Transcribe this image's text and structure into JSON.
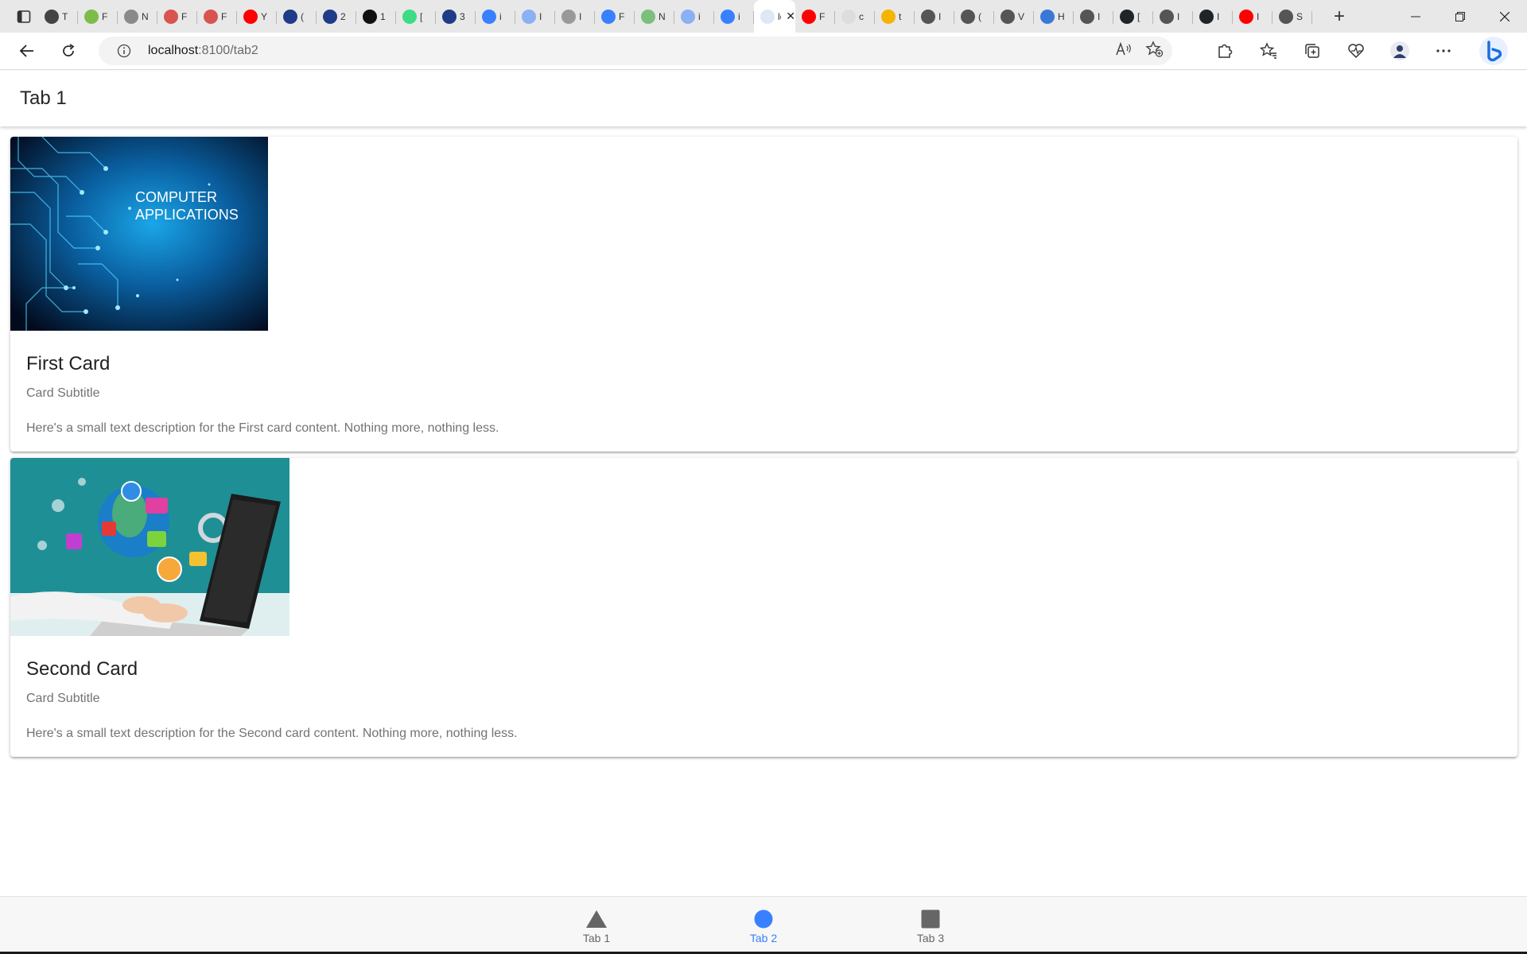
{
  "browser": {
    "tabs": [
      {
        "icon": "copilot-icon",
        "color": "#444",
        "label": "T"
      },
      {
        "icon": "w-icon",
        "color": "#7cbd4a",
        "label": "F"
      },
      {
        "icon": "person-icon",
        "color": "#8a8a8a",
        "label": "N"
      },
      {
        "icon": "pdf-icon",
        "color": "#d9534f",
        "label": "F"
      },
      {
        "icon": "pdf-icon",
        "color": "#d9534f",
        "label": "F"
      },
      {
        "icon": "youtube-icon",
        "color": "#ff0000",
        "label": "Y"
      },
      {
        "icon": "c-icon",
        "color": "#1f3c88",
        "label": "("
      },
      {
        "icon": "c-icon",
        "color": "#1f3c88",
        "label": "2"
      },
      {
        "icon": "o-icon",
        "color": "#111111",
        "label": "1"
      },
      {
        "icon": "android-icon",
        "color": "#3ddc84",
        "label": "["
      },
      {
        "icon": "c-icon",
        "color": "#1f3c88",
        "label": "3"
      },
      {
        "icon": "ionic-icon",
        "color": "#3880ff",
        "label": "i"
      },
      {
        "icon": "ionic-icon",
        "color": "#8ab0f5",
        "label": "I"
      },
      {
        "icon": "wiki-icon",
        "color": "#999999",
        "label": "I"
      },
      {
        "icon": "ionic-icon",
        "color": "#3880ff",
        "label": "F"
      },
      {
        "icon": "node-icon",
        "color": "#7cbf7c",
        "label": "N"
      },
      {
        "icon": "ionic-icon",
        "color": "#8ab0f5",
        "label": "i"
      },
      {
        "icon": "ionic-icon",
        "color": "#3880ff",
        "label": "i"
      }
    ],
    "active_tab": {
      "label": "lo",
      "close": "✕"
    },
    "tabs_after": [
      {
        "icon": "youtube-icon",
        "color": "#ff0000",
        "label": "F"
      },
      {
        "icon": "google-icon",
        "color": "#dddddd",
        "label": "c"
      },
      {
        "icon": "drive-icon",
        "color": "#f4b400",
        "label": "t"
      },
      {
        "icon": "page-icon",
        "color": "#555555",
        "label": "I"
      },
      {
        "icon": "github-icon",
        "color": "#555555",
        "label": "("
      },
      {
        "icon": "page-icon",
        "color": "#555555",
        "label": "V"
      },
      {
        "icon": "shield-icon",
        "color": "#3a78d8",
        "label": "H"
      },
      {
        "icon": "page-icon",
        "color": "#555555",
        "label": "I"
      },
      {
        "icon": "react-icon",
        "color": "#20232a",
        "label": "["
      },
      {
        "icon": "page-icon",
        "color": "#555555",
        "label": "I"
      },
      {
        "icon": "react-icon",
        "color": "#20232a",
        "label": "I"
      },
      {
        "icon": "youtube-icon",
        "color": "#ff0000",
        "label": "I"
      },
      {
        "icon": "gear-icon",
        "color": "#555555",
        "label": "S"
      }
    ],
    "new_tab": "+",
    "url_host": "localhost",
    "url_path": ":8100/tab2"
  },
  "header": {
    "title": "Tab 1"
  },
  "cards": [
    {
      "image_text_line1": "COMPUTER",
      "image_text_line2": "APPLICATIONS",
      "title": "First Card",
      "subtitle": "Card Subtitle",
      "content": "Here's a small text description for the First card content. Nothing more, nothing less."
    },
    {
      "title": "Second Card",
      "subtitle": "Card Subtitle",
      "content": "Here's a small text description for the Second card content. Nothing more, nothing less."
    }
  ],
  "tabbar": {
    "tabs": [
      {
        "label": "Tab 1",
        "icon": "triangle-icon"
      },
      {
        "label": "Tab 2",
        "icon": "circle-icon",
        "selected": true
      },
      {
        "label": "Tab 3",
        "icon": "square-icon"
      }
    ]
  },
  "colors": {
    "accent": "#3880ff",
    "tab_icon": "#666666"
  }
}
